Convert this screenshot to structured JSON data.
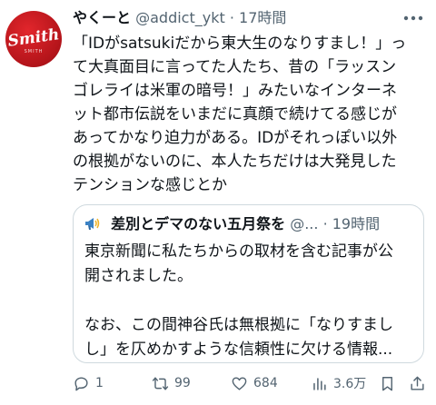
{
  "tweet": {
    "avatar_text": "Smith",
    "avatar_subtext": "SMITH",
    "author_name": "やくーと",
    "author_handle": "@addict_ykt",
    "separator": "·",
    "time": "17時間",
    "more_icon": "more-horizontal-icon",
    "body_lines": [
      "「IDがsatsukiだから東大生のなりすまし！」っ",
      "て大真面目に言ってた人たち、昔の「ラッスン",
      "ゴレライは米軍の暗号！」みたいなインターネ",
      "ット都市伝説をいまだに真顔で続けてる感じが",
      "あってかなり迫力がある。IDがそれっぽい以外",
      "の根拠がないのに、本人たちだけは大発見した",
      "テンションな感じとか"
    ]
  },
  "quoted": {
    "icon": "megaphone-icon",
    "author_name": "差別とデマのない五月祭を",
    "author_handle": "@...",
    "separator": "·",
    "time": "19時間",
    "lines": [
      "東京新聞に私たちからの取材を含む記事が公",
      "開されました。",
      "",
      "なお、この間神谷氏は無根拠に「なりすまし",
      "し」を仄めかすような信頼性に欠ける情報..."
    ]
  },
  "actions": {
    "reply_count": "1",
    "repost_count": "99",
    "like_count": "684",
    "views_count": "3.6万",
    "icons": [
      "reply-icon",
      "repost-icon",
      "like-icon",
      "views-icon",
      "bookmark-icon",
      "share-icon"
    ]
  },
  "colors": {
    "text": "#0f1419",
    "muted": "#536471",
    "border": "#cfd9de",
    "avatar_red": "#c8181e"
  }
}
